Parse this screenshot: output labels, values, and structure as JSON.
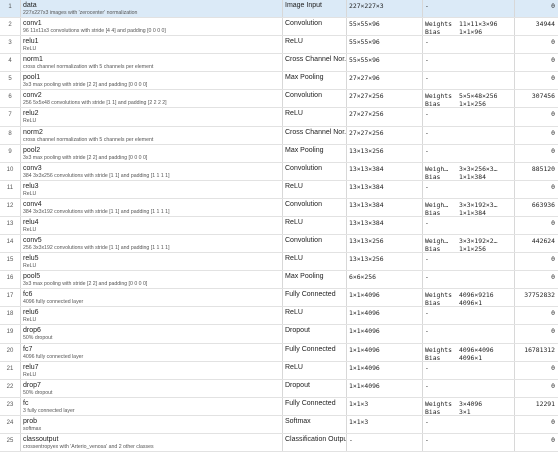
{
  "layers": [
    {
      "index": "1",
      "name": "data",
      "desc": "227x227x3 images with 'zerocenter' normalization",
      "type": "Image Input",
      "activations": "227×227×3",
      "learnables": [
        {
          "k": "-",
          "v": ""
        }
      ],
      "total": "0",
      "selected": true
    },
    {
      "index": "2",
      "name": "conv1",
      "desc": "96 11x11x3 convolutions with stride [4 4] and padding [0 0 0 0]",
      "type": "Convolution",
      "activations": "55×55×96",
      "learnables": [
        {
          "k": "Weights",
          "v": "11×11×3×96"
        },
        {
          "k": "Bias",
          "v": "1×1×96"
        }
      ],
      "total": "34944"
    },
    {
      "index": "3",
      "name": "relu1",
      "desc": "ReLU",
      "type": "ReLU",
      "activations": "55×55×96",
      "learnables": [
        {
          "k": "-",
          "v": ""
        }
      ],
      "total": "0"
    },
    {
      "index": "4",
      "name": "norm1",
      "desc": "cross channel normalization with 5 channels per element",
      "type": "Cross Channel Nor...",
      "activations": "55×55×96",
      "learnables": [
        {
          "k": "-",
          "v": ""
        }
      ],
      "total": "0"
    },
    {
      "index": "5",
      "name": "pool1",
      "desc": "3x3 max pooling with stride [2 2] and padding [0 0 0 0]",
      "type": "Max Pooling",
      "activations": "27×27×96",
      "learnables": [
        {
          "k": "-",
          "v": ""
        }
      ],
      "total": "0"
    },
    {
      "index": "6",
      "name": "conv2",
      "desc": "256 5x5x48 convolutions with stride [1 1] and padding [2 2 2 2]",
      "type": "Convolution",
      "activations": "27×27×256",
      "learnables": [
        {
          "k": "Weights",
          "v": "5×5×48×256"
        },
        {
          "k": "Bias",
          "v": "1×1×256"
        }
      ],
      "total": "307456"
    },
    {
      "index": "7",
      "name": "relu2",
      "desc": "ReLU",
      "type": "ReLU",
      "activations": "27×27×256",
      "learnables": [
        {
          "k": "-",
          "v": ""
        }
      ],
      "total": "0"
    },
    {
      "index": "8",
      "name": "norm2",
      "desc": "cross channel normalization with 5 channels per element",
      "type": "Cross Channel Nor...",
      "activations": "27×27×256",
      "learnables": [
        {
          "k": "-",
          "v": ""
        }
      ],
      "total": "0"
    },
    {
      "index": "9",
      "name": "pool2",
      "desc": "3x3 max pooling with stride [2 2] and padding [0 0 0 0]",
      "type": "Max Pooling",
      "activations": "13×13×256",
      "learnables": [
        {
          "k": "-",
          "v": ""
        }
      ],
      "total": "0"
    },
    {
      "index": "10",
      "name": "conv3",
      "desc": "384 3x3x256 convolutions with stride [1 1] and padding [1 1 1 1]",
      "type": "Convolution",
      "activations": "13×13×384",
      "learnables": [
        {
          "k": "Weigh…",
          "v": "3×3×256×3…"
        },
        {
          "k": "Bias",
          "v": "1×1×384"
        }
      ],
      "total": "885120"
    },
    {
      "index": "11",
      "name": "relu3",
      "desc": "ReLU",
      "type": "ReLU",
      "activations": "13×13×384",
      "learnables": [
        {
          "k": "-",
          "v": ""
        }
      ],
      "total": "0"
    },
    {
      "index": "12",
      "name": "conv4",
      "desc": "384 3x3x192 convolutions with stride [1 1] and padding [1 1 1 1]",
      "type": "Convolution",
      "activations": "13×13×384",
      "learnables": [
        {
          "k": "Weigh…",
          "v": "3×3×192×3…"
        },
        {
          "k": "Bias",
          "v": "1×1×384"
        }
      ],
      "total": "663936"
    },
    {
      "index": "13",
      "name": "relu4",
      "desc": "ReLU",
      "type": "ReLU",
      "activations": "13×13×384",
      "learnables": [
        {
          "k": "-",
          "v": ""
        }
      ],
      "total": "0"
    },
    {
      "index": "14",
      "name": "conv5",
      "desc": "256 3x3x192 convolutions with stride [1 1] and padding [1 1 1 1]",
      "type": "Convolution",
      "activations": "13×13×256",
      "learnables": [
        {
          "k": "Weigh…",
          "v": "3×3×192×2…"
        },
        {
          "k": "Bias",
          "v": "1×1×256"
        }
      ],
      "total": "442624"
    },
    {
      "index": "15",
      "name": "relu5",
      "desc": "ReLU",
      "type": "ReLU",
      "activations": "13×13×256",
      "learnables": [
        {
          "k": "-",
          "v": ""
        }
      ],
      "total": "0"
    },
    {
      "index": "16",
      "name": "pool5",
      "desc": "3x3 max pooling with stride [2 2] and padding [0 0 0 0]",
      "type": "Max Pooling",
      "activations": "6×6×256",
      "learnables": [
        {
          "k": "-",
          "v": ""
        }
      ],
      "total": "0"
    },
    {
      "index": "17",
      "name": "fc6",
      "desc": "4096 fully connected layer",
      "type": "Fully Connected",
      "activations": "1×1×4096",
      "learnables": [
        {
          "k": "Weights",
          "v": "4096×9216"
        },
        {
          "k": "Bias",
          "v": "4096×1"
        }
      ],
      "total": "37752832"
    },
    {
      "index": "18",
      "name": "relu6",
      "desc": "ReLU",
      "type": "ReLU",
      "activations": "1×1×4096",
      "learnables": [
        {
          "k": "-",
          "v": ""
        }
      ],
      "total": "0"
    },
    {
      "index": "19",
      "name": "drop6",
      "desc": "50% dropout",
      "type": "Dropout",
      "activations": "1×1×4096",
      "learnables": [
        {
          "k": "-",
          "v": ""
        }
      ],
      "total": "0"
    },
    {
      "index": "20",
      "name": "fc7",
      "desc": "4096 fully connected layer",
      "type": "Fully Connected",
      "activations": "1×1×4096",
      "learnables": [
        {
          "k": "Weights",
          "v": "4096×4096"
        },
        {
          "k": "Bias",
          "v": "4096×1"
        }
      ],
      "total": "16781312"
    },
    {
      "index": "21",
      "name": "relu7",
      "desc": "ReLU",
      "type": "ReLU",
      "activations": "1×1×4096",
      "learnables": [
        {
          "k": "-",
          "v": ""
        }
      ],
      "total": "0"
    },
    {
      "index": "22",
      "name": "drop7",
      "desc": "50% dropout",
      "type": "Dropout",
      "activations": "1×1×4096",
      "learnables": [
        {
          "k": "-",
          "v": ""
        }
      ],
      "total": "0"
    },
    {
      "index": "23",
      "name": "fc",
      "desc": "3 fully connected layer",
      "type": "Fully Connected",
      "activations": "1×1×3",
      "learnables": [
        {
          "k": "Weights",
          "v": "3×4096"
        },
        {
          "k": "Bias",
          "v": "3×1"
        }
      ],
      "total": "12291"
    },
    {
      "index": "24",
      "name": "prob",
      "desc": "softmax",
      "type": "Softmax",
      "activations": "1×1×3",
      "learnables": [
        {
          "k": "-",
          "v": ""
        }
      ],
      "total": "0"
    },
    {
      "index": "25",
      "name": "classoutput",
      "desc": "crossentropyex with 'Arterio_venosa' and 2 other classes",
      "type": "Classification Output",
      "activations": "-",
      "learnables": [
        {
          "k": "-",
          "v": ""
        }
      ],
      "total": "0"
    }
  ]
}
